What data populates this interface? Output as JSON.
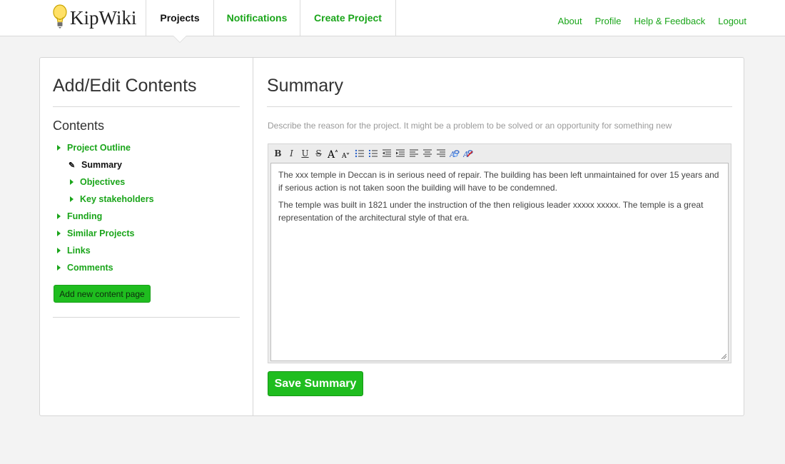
{
  "app": {
    "name": "KipWiki",
    "brand_color": "#1aa51a",
    "icon": "lightbulb-icon"
  },
  "nav": {
    "tabs": [
      {
        "label": "Projects",
        "active": true
      },
      {
        "label": "Notifications",
        "active": false
      },
      {
        "label": "Create Project",
        "active": false
      }
    ],
    "links": [
      {
        "label": "About"
      },
      {
        "label": "Profile"
      },
      {
        "label": "Help & Feedback"
      },
      {
        "label": "Logout"
      }
    ]
  },
  "sidebar": {
    "title": "Add/Edit Contents",
    "contents_heading": "Contents",
    "items": [
      {
        "label": "Project Outline",
        "level": 0,
        "icon": "triangle-right-icon",
        "current": false
      },
      {
        "label": "Summary",
        "level": 1,
        "icon": "pencil-icon",
        "current": true
      },
      {
        "label": "Objectives",
        "level": 1,
        "icon": "triangle-right-icon",
        "current": false
      },
      {
        "label": "Key stakeholders",
        "level": 1,
        "icon": "triangle-right-icon",
        "current": false
      },
      {
        "label": "Funding",
        "level": 0,
        "icon": "triangle-right-icon",
        "current": false
      },
      {
        "label": "Similar Projects",
        "level": 0,
        "icon": "triangle-right-icon",
        "current": false
      },
      {
        "label": "Links",
        "level": 0,
        "icon": "triangle-right-icon",
        "current": false
      },
      {
        "label": "Comments",
        "level": 0,
        "icon": "triangle-right-icon",
        "current": false
      }
    ],
    "add_button": "Add new content page"
  },
  "main": {
    "title": "Summary",
    "hint": "Describe the reason for the project. It might be a problem to be solved or an opportunity for something new",
    "toolbar": {
      "bold": "B",
      "italic": "I",
      "underline": "U",
      "strike": "S"
    },
    "editor_text": {
      "p1": "The xxx temple in Deccan is in serious need of repair. The building has been left unmaintained for over 15 years and if serious action is not taken soon the building will have to be condemned.",
      "p2": "The temple was built in 1821 under the instruction of the then religious leader xxxxx xxxxx. The temple is a great representation of the architectural style of that era."
    },
    "save_button": "Save Summary"
  }
}
